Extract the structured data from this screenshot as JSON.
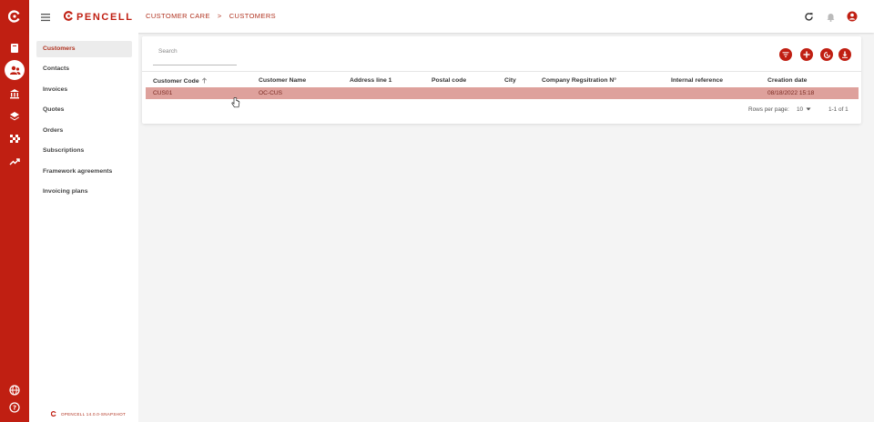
{
  "app": {
    "logo_text": "PENCELL",
    "version": "OPENCELL 14.0.0-SNAPSHOT"
  },
  "breadcrumb": {
    "section": "CUSTOMER CARE",
    "separator": ">",
    "page": "CUSTOMERS"
  },
  "rail": {
    "icons": [
      "logo-icon",
      "book-icon",
      "customers-icon",
      "bank-icon",
      "layers-icon",
      "checkered-icon",
      "trending-icon",
      "globe-icon",
      "help-icon"
    ],
    "active": "customers-icon"
  },
  "sidebar": {
    "items": [
      {
        "label": "Customers",
        "active": true
      },
      {
        "label": "Contacts"
      },
      {
        "label": "Invoices"
      },
      {
        "label": "Quotes"
      },
      {
        "label": "Orders"
      },
      {
        "label": "Subscriptions"
      },
      {
        "label": "Framework agreements"
      },
      {
        "label": "Invoicing plans"
      }
    ]
  },
  "search": {
    "placeholder": "Search"
  },
  "actions": [
    "filter-icon",
    "add-icon",
    "history-icon",
    "download-icon"
  ],
  "table": {
    "columns": [
      {
        "label": "Customer Code",
        "sorted": "asc"
      },
      {
        "label": "Customer Name"
      },
      {
        "label": "Address line 1"
      },
      {
        "label": "Postal code"
      },
      {
        "label": "City"
      },
      {
        "label": "Company Regsitration N°"
      },
      {
        "label": "Internal reference"
      },
      {
        "label": "Creation date"
      }
    ],
    "rows": [
      {
        "code": "CUS01",
        "name": "OC-CUS",
        "address": "",
        "postal": "",
        "city": "",
        "registration": "",
        "reference": "",
        "created": "08/18/2022 15:18"
      }
    ]
  },
  "pagination": {
    "rows_per_page_label": "Rows per page:",
    "rows_per_page": "10",
    "range": "1-1 of 1"
  },
  "colors": {
    "brand": "#c01f12",
    "row_selected": "#dea19c",
    "sidebar_active_bg": "#ececec"
  }
}
